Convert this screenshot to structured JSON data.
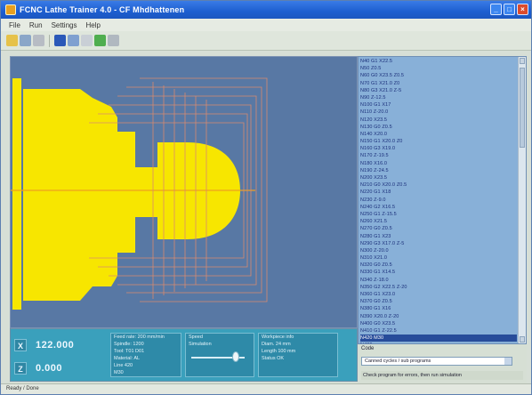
{
  "window": {
    "title": "FCNC Lathe Trainer 4.0 - CF Mhdhattenen"
  },
  "menu": [
    "File",
    "Run",
    "Settings",
    "Help"
  ],
  "toolbar": {
    "icons": [
      "open-icon",
      "save-icon",
      "print-icon",
      "run-icon",
      "step-icon",
      "stop-icon",
      "reset-icon",
      "help-icon"
    ]
  },
  "colors": {
    "workpiece": "#f7e600",
    "sim_background": "#5878a4",
    "tool_path": "#d98a6e",
    "center_line": "#f0a020",
    "listing_background": "#88b0d8",
    "info_panel": "#3aa0bc"
  },
  "listing": {
    "current_index": 38,
    "lines": [
      "N40 G1 X22.5",
      "N50 Z0.5",
      "N60 G0 X23.5 Z0.5",
      "N70 G1 X21.0 Z0",
      "N80 G3 X21.0 Z-5",
      "N90 Z-12.5",
      "N100 G1 X17",
      "N110 Z-20.0",
      "N120 X23.5",
      "N130 G0 Z0.5",
      "N140 X20.0",
      "N150 G1 X20.0 Z0",
      "N160 G3 X19.0",
      "N170 Z-19.5",
      "N180 X16.0",
      "N190 Z-24.5",
      "N200 X23.5",
      "N210 G0 X20.0 Z0.5",
      "N220 G1 X18",
      "N230 Z-9.0",
      "N240 G2 X16.5",
      "N250 G1 Z-15.5",
      "N260 X21.5",
      "N270 G0 Z0.5",
      "N280 G1 X23",
      "N290 G3 X17.0 Z-5",
      "N300 Z-20.0",
      "N310 X21.0",
      "N320 G0 Z0.5",
      "N330 G1 X14.5",
      "N340 Z-18.0",
      "N350 G2 X22.5 Z-20",
      "N360 G1 X23.0",
      "N370 G0 Z0.5",
      "N380 G1 X16",
      "N390 X20.0 Z-20",
      "N400 G0 X23.5",
      "N410 G1 Z-22.5",
      "N420 M30",
      "N430"
    ]
  },
  "coordinates": {
    "x_label": "X",
    "x_value": "122.000",
    "z_label": "Z",
    "z_value": "0.000"
  },
  "info_boxes": {
    "box1": [
      "Feed rate: 200 mm/min",
      "Spindle: 1200",
      "Tool: T01 D01",
      "Material: AL",
      "Line 420",
      "M30"
    ],
    "box2": [
      "Speed",
      "Simulation"
    ],
    "box3": [
      "Workpiece info",
      "Diam. 24 mm",
      "Length 100 mm",
      "Status OK"
    ]
  },
  "bottom_right": {
    "label": "Code",
    "select_value": "Canned cycles / sub programs",
    "footer": "Check program for errors, then run simulation"
  },
  "status": "Ready / Done"
}
